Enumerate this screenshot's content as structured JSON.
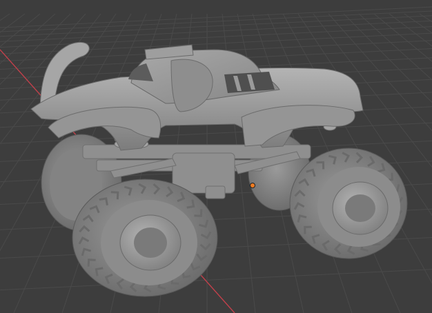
{
  "viewport": {
    "editor": "3D Viewport",
    "background_color": "#3d3d3d",
    "grid_color": "#4a4a4a",
    "x_axis_color": "#c2404b",
    "origin_color": "#f07c22",
    "grid_visible": true
  },
  "object": {
    "type": "monster-truck-mesh",
    "shading": "solid",
    "base_color": "#9a9a9a"
  },
  "icons": {
    "origin_marker": "origin-dot-icon"
  }
}
